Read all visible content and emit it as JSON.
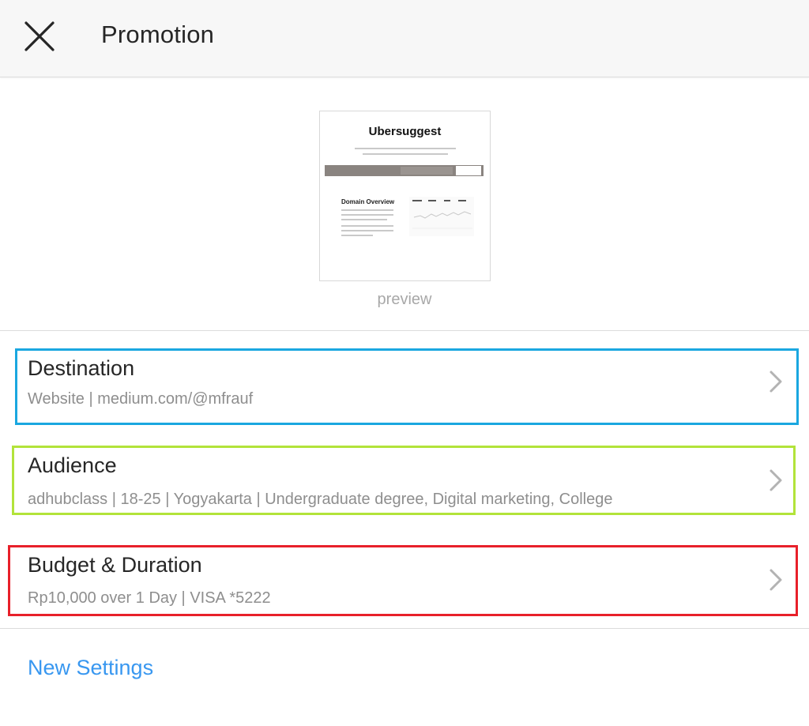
{
  "header": {
    "title": "Promotion",
    "close_icon": "close-icon"
  },
  "preview": {
    "thumbnail_title": "Ubersuggest",
    "thumbnail_subheading": "Domain Overview",
    "label": "preview"
  },
  "rows": [
    {
      "title": "Destination",
      "subtitle": "Website | medium.com/@mfrauf",
      "highlight_color": "#1aa7e0"
    },
    {
      "title": "Audience",
      "subtitle": "adhubclass | 18-25 | Yogyakarta | Undergraduate degree, Digital marketing, College",
      "highlight_color": "#b2e33a"
    },
    {
      "title": "Budget & Duration",
      "subtitle": "Rp10,000 over 1 Day | VISA *5222",
      "highlight_color": "#e8202a"
    }
  ],
  "footer": {
    "new_settings_label": "New Settings",
    "link_color": "#3897f0"
  }
}
